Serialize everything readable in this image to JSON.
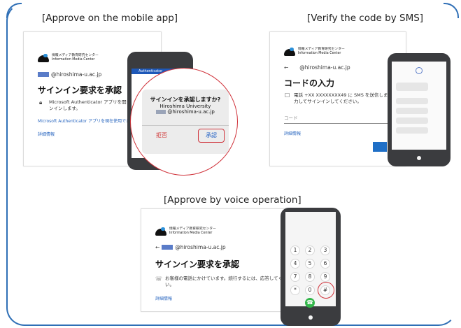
{
  "captions": {
    "mobile_app": "[Approve on the mobile app]",
    "sms": "[Verify the code by SMS]",
    "voice": "[Approve by voice operation]"
  },
  "logo": {
    "line1": "情報メディア教育研究センター",
    "line2": "Information Media Center"
  },
  "panel_app": {
    "account": "@hiroshima-u.ac.jp",
    "heading": "サインイン要求を承認",
    "body_line1": "Microsoft Authenticator アプリを開き",
    "body_line2": "ンインします。",
    "link_unavailable": "Microsoft Authenticator アプリを現在使用できませ",
    "link_details": "詳細情報",
    "phone_app_title": "Authenticator",
    "dialog": {
      "title": "サインインを承認しますか?",
      "org": "Hiroshima University",
      "email": "@hiroshima-u.ac.jp",
      "deny": "拒否",
      "approve": "承認"
    }
  },
  "panel_sms": {
    "back_arrow": "←",
    "account": "@hiroshima-u.ac.jp",
    "heading": "コードの入力",
    "body_line1": "電話 +XX XXXXXXXX49 に SMS を送信しまし",
    "body_line2": "力してサインインしてください。",
    "code_placeholder": "コード",
    "link_details": "詳細情報"
  },
  "panel_voice": {
    "back_arrow": "←",
    "account": "@hiroshima-u.ac.jp",
    "heading": "サインイン要求を承認",
    "body_line1": "お客様の電話にかけています。続行するには、応答してくださ",
    "body_line2": "い。",
    "link_details": "詳細情報",
    "keys": [
      "1",
      "2",
      "3",
      "4",
      "5",
      "6",
      "7",
      "8",
      "9",
      "*",
      "0",
      "#"
    ]
  },
  "colors": {
    "frame": "#2f6fb6",
    "highlight": "#d0333b",
    "link": "#2a67c0",
    "phone_body": "#3b3c3f",
    "call_green": "#32b64a"
  }
}
